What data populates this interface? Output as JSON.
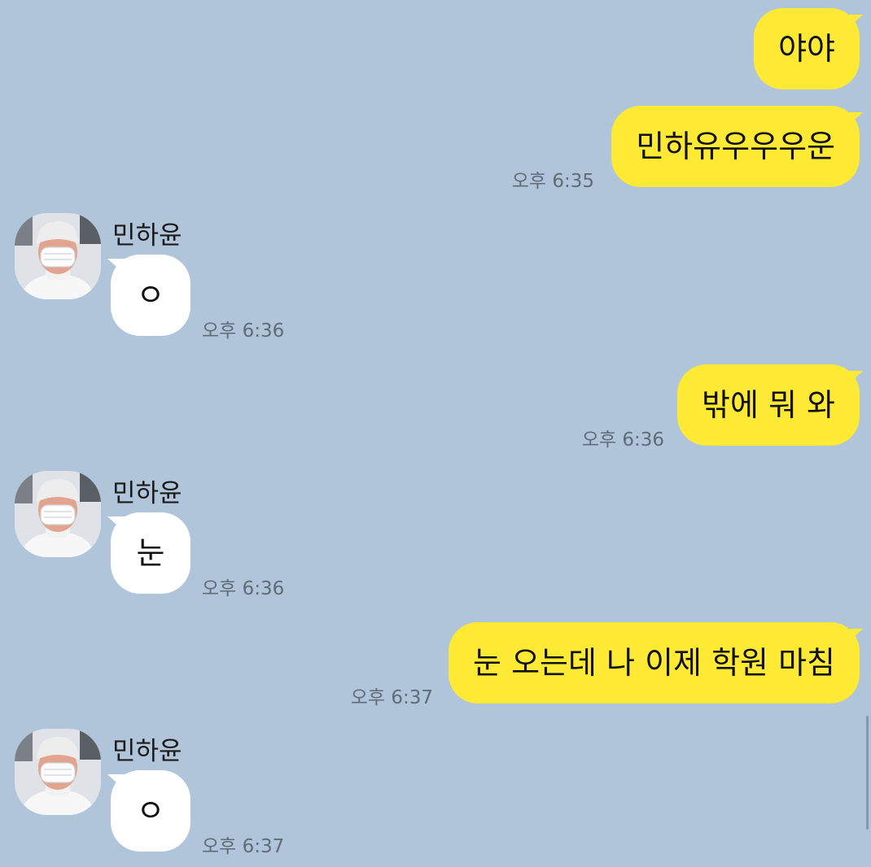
{
  "conversation": {
    "contact_name": "민하윤",
    "messages": [
      {
        "side": "out",
        "text": "야야",
        "time": ""
      },
      {
        "side": "out",
        "text": "민하유우우우운",
        "time": "오후 6:35"
      },
      {
        "side": "in",
        "sender": "민하윤",
        "text": "ㅇ",
        "time": "오후 6:36"
      },
      {
        "side": "out",
        "text": "밖에 뭐 와",
        "time": "오후 6:36"
      },
      {
        "side": "in",
        "sender": "민하윤",
        "text": "눈",
        "time": "오후 6:36"
      },
      {
        "side": "out",
        "text": "눈 오는데 나 이제 학원 마침",
        "time": "오후 6:37"
      },
      {
        "side": "in",
        "sender": "민하윤",
        "text": "ㅇ",
        "time": "오후 6:37"
      }
    ]
  },
  "colors": {
    "background": "#b1c5da",
    "outgoing_bubble": "#fee934",
    "incoming_bubble": "#ffffff",
    "timestamp": "#5f6c79"
  },
  "icons": {
    "avatar": "profile-photo-avatar"
  }
}
